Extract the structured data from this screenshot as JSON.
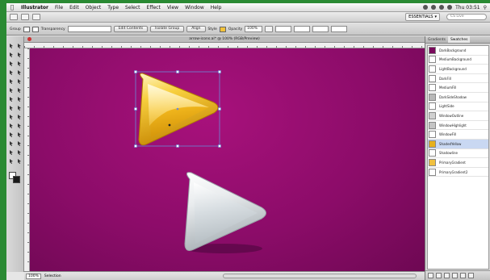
{
  "menubar": {
    "app": "Illustrator",
    "items": [
      "File",
      "Edit",
      "Object",
      "Type",
      "Select",
      "Effect",
      "View",
      "Window",
      "Help"
    ],
    "clock": "Thu 03:51"
  },
  "appbar": {
    "workspace": "ESSENTIALS",
    "search_placeholder": "CS Live"
  },
  "controlbar": {
    "selection_label": "Group",
    "stroke_label": "Transparency",
    "fill_value": "",
    "opacity_label": "Opacity",
    "opacity_value": "100%",
    "recolor_button": "Edit Contents",
    "isolate_button": "Isolate Group",
    "align_button": "Align",
    "style_label": "Style"
  },
  "document": {
    "tab_title": "arrow-icons.ai* @ 100% (RGB/Preview)",
    "zoom": "100%",
    "status": "Selection"
  },
  "swatches_panel": {
    "tabs": [
      "Gradients",
      "Swatches"
    ],
    "active_tab": "Swatches",
    "items": [
      {
        "name": "DarkBackground",
        "color": "#7a0a5c"
      },
      {
        "name": "MediumBackground",
        "color": "#ffffff"
      },
      {
        "name": "LightBackground",
        "color": "#ffffff"
      },
      {
        "name": "DarkFill",
        "color": "#ffffff"
      },
      {
        "name": "MediumFill",
        "color": "#ffffff"
      },
      {
        "name": "DarkSideShadow",
        "color": "#b8b8b8"
      },
      {
        "name": "LightSide",
        "color": "#ffffff"
      },
      {
        "name": "WindowOutline",
        "color": "#d0d0d0"
      },
      {
        "name": "WindowHighlight",
        "color": "#c4c4c4"
      },
      {
        "name": "WindowFill",
        "color": "#ffffff"
      },
      {
        "name": "ShadedYellow",
        "color": "#e6b01c"
      },
      {
        "name": "Shadowline",
        "color": "#ffffff"
      },
      {
        "name": "PrimaryGradient",
        "color": "#f0c040"
      },
      {
        "name": "PrimaryGradient2",
        "color": "#ffffff"
      }
    ],
    "selected_index": 10
  },
  "colors": {
    "canvas": "#8c0c69",
    "selection": "#6a8ad8"
  }
}
